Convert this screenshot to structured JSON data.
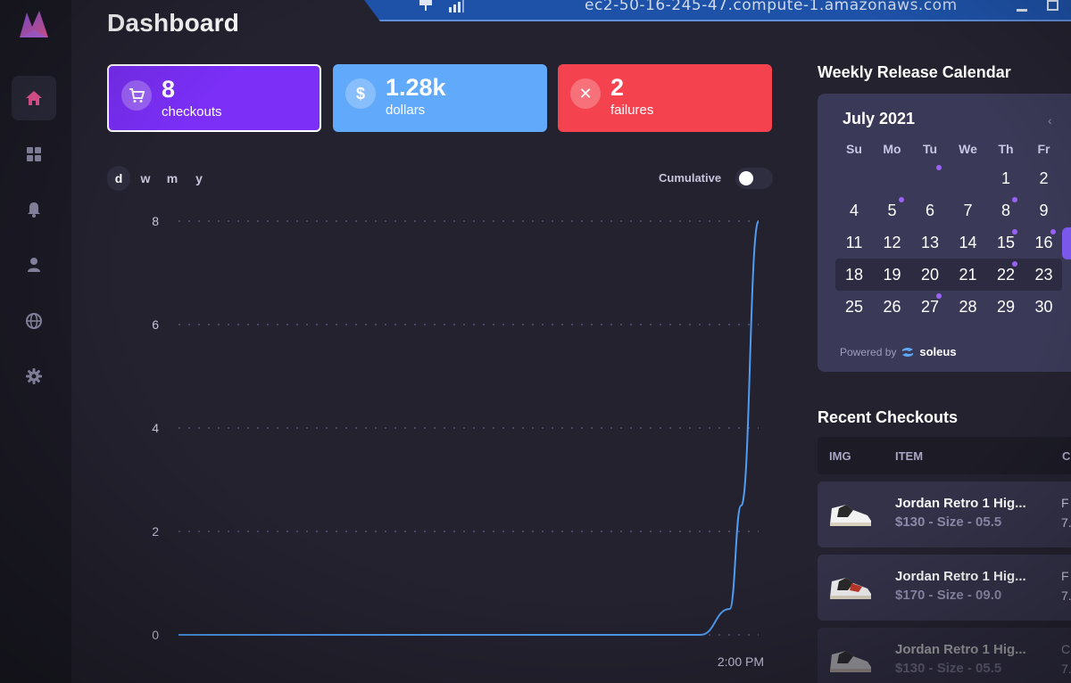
{
  "window": {
    "remote_host": "ec2-50-16-245-47.compute-1.amazonaws.com"
  },
  "page": {
    "title": "Dashboard"
  },
  "sidebar": {
    "items": [
      {
        "name": "home",
        "icon": "home-icon",
        "active": true
      },
      {
        "name": "dashboard",
        "icon": "grid-icon",
        "active": false
      },
      {
        "name": "notifications",
        "icon": "bell-icon",
        "active": false
      },
      {
        "name": "profile",
        "icon": "user-icon",
        "active": false
      },
      {
        "name": "proxies",
        "icon": "globe-icon",
        "active": false
      },
      {
        "name": "settings",
        "icon": "gear-icon",
        "active": false
      }
    ]
  },
  "stats": [
    {
      "value": "8",
      "label": "checkouts",
      "icon": "cart-icon",
      "color": "#7b2ff7"
    },
    {
      "value": "1.28k",
      "label": "dollars",
      "icon": "dollar-icon",
      "color": "#61a9fa"
    },
    {
      "value": "2",
      "label": "failures",
      "icon": "x-icon",
      "color": "#f5424f"
    }
  ],
  "chart_controls": {
    "ranges": [
      "d",
      "w",
      "m",
      "y"
    ],
    "active_range": "d",
    "cumulative_label": "Cumulative",
    "cumulative_on": false
  },
  "chart_data": {
    "type": "line",
    "title": "",
    "xlabel": "",
    "ylabel": "",
    "y_ticks": [
      "8",
      "6",
      "4",
      "2",
      "0"
    ],
    "ylim": [
      0,
      8
    ],
    "x_tick_label": "2:00 PM",
    "grid": "dotted horizontal",
    "series": [
      {
        "values_x": [
          0,
          0.5,
          0.9,
          0.95,
          0.97,
          1.0
        ],
        "values_y": [
          0,
          0,
          0,
          0.5,
          2.5,
          8
        ]
      }
    ],
    "line_color": "#4f9cf0"
  },
  "calendar": {
    "section_title": "Weekly Release Calendar",
    "month": "July 2021",
    "prev_glyph": "‹",
    "days_of_week": [
      "Su",
      "Mo",
      "Tu",
      "We",
      "Th",
      "Fr"
    ],
    "weeks": [
      [
        "",
        "",
        "",
        "",
        "1",
        "2"
      ],
      [
        "4",
        "5",
        "6",
        "7",
        "8",
        "9"
      ],
      [
        "11",
        "12",
        "13",
        "14",
        "15",
        "16"
      ],
      [
        "18",
        "19",
        "20",
        "21",
        "22",
        "23"
      ],
      [
        "25",
        "26",
        "27",
        "28",
        "29",
        "30"
      ]
    ],
    "release_dots": [
      "0-2",
      "1-1",
      "1-4",
      "2-4",
      "2-5",
      "3-4",
      "4-2"
    ],
    "highlight_week": 3,
    "powered_by": "Powered by",
    "powered_brand": "soleus"
  },
  "checkouts": {
    "section_title": "Recent Checkouts",
    "columns": [
      "IMG",
      "ITEM",
      "C"
    ],
    "rows": [
      {
        "item": "Jordan Retro 1 Hig...",
        "detail": "$130 - Size - 05.5",
        "extra_top": "F",
        "extra_bottom": "7."
      },
      {
        "item": "Jordan Retro 1 Hig...",
        "detail": "$170 - Size - 09.0",
        "extra_top": "F",
        "extra_bottom": "7."
      },
      {
        "item": "Jordan Retro 1 Hig...",
        "detail": "$130 - Size - 05.5",
        "extra_top": "C",
        "extra_bottom": "7."
      }
    ]
  }
}
